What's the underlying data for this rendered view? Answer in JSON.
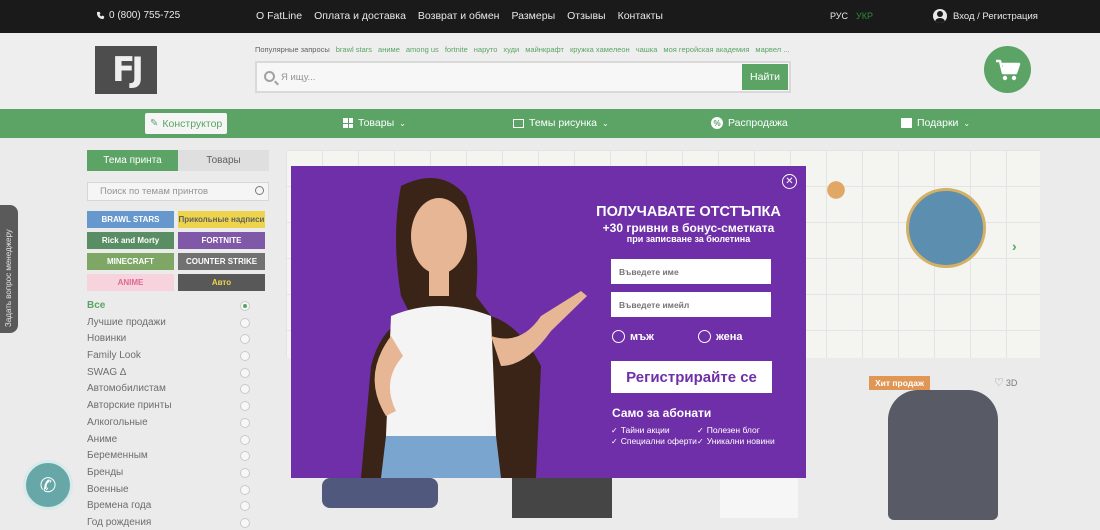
{
  "topbar": {
    "phone": "0 (800) 755-725",
    "nav": [
      "О FatLine",
      "Оплата и доставка",
      "Возврат и обмен",
      "Размеры",
      "Отзывы",
      "Контакты"
    ],
    "lang_active": "РУС",
    "lang_inactive": "УКР",
    "auth": "Вход / Регистрация"
  },
  "header": {
    "logo_text": "FJ",
    "popular_label": "Популярные запросы",
    "popular_tags": [
      "brawl stars",
      "аниме",
      "among us",
      "fortnite",
      "наруто",
      "худи",
      "майнкрафт",
      "кружка хамелеон",
      "чашка",
      "моя геройская академия",
      "марвел ..."
    ],
    "search_placeholder": "Я ищу...",
    "search_button": "Найти"
  },
  "greennav": {
    "constructor": "Конструктор",
    "goods": "Товары",
    "themes": "Темы рисунка",
    "sale": "Распродажа",
    "gifts": "Подарки"
  },
  "sidebar": {
    "tab_active": "Тема принта",
    "tab_inactive": "Товары",
    "search_placeholder": "Поиск по темам принтов",
    "thumbs": [
      {
        "label": "BRAWL STARS",
        "bg": "#3b7bbf"
      },
      {
        "label": "Прикольные надписи",
        "bg": "#e8c81a"
      },
      {
        "label": "Rick and Morty",
        "bg": "#2b6f3a"
      },
      {
        "label": "FORTNITE",
        "bg": "#5b2a8f"
      },
      {
        "label": "MINECRAFT",
        "bg": "#5a8f3a"
      },
      {
        "label": "COUNTER STRIKE",
        "bg": "#4a4a4a"
      },
      {
        "label": "ANIME",
        "bg": "#f5c8d4"
      },
      {
        "label": "Авто",
        "bg": "#2a2a2a"
      }
    ],
    "categories": [
      "Все",
      "Лучшие продажи",
      "Новинки",
      "Family Look",
      "SWAG ∆",
      "Автомобилистам",
      "Авторские принты",
      "Алкогольные",
      "Аниме",
      "Беременным",
      "Бренды",
      "Военные",
      "Времена года",
      "Год рождения"
    ]
  },
  "products": {
    "badge": "Хит продаж",
    "view_3d": "3D"
  },
  "side_widget": {
    "label": "Задать вопрос менеджеру"
  },
  "popup": {
    "title": "ПОЛУЧАВАТЕ ОТСТЪПКА",
    "subtitle1": "+30 гривни в бонус-сметката",
    "subtitle2": "при записване за бюлетина",
    "name_placeholder": "Въведете име",
    "email_placeholder": "Въведете имейл",
    "male": "мъж",
    "female": "жена",
    "register_button": "Регистрирайте се",
    "subs_title": "Само за абонати",
    "benefits": [
      "Тайни акции",
      "Полезен блог",
      "Специални оферти",
      "Уникални новини"
    ]
  },
  "colors": {
    "brand_green": "#2e8b3a",
    "popup_purple": "#6f2fa8",
    "topbar": "#1a1a1a"
  }
}
